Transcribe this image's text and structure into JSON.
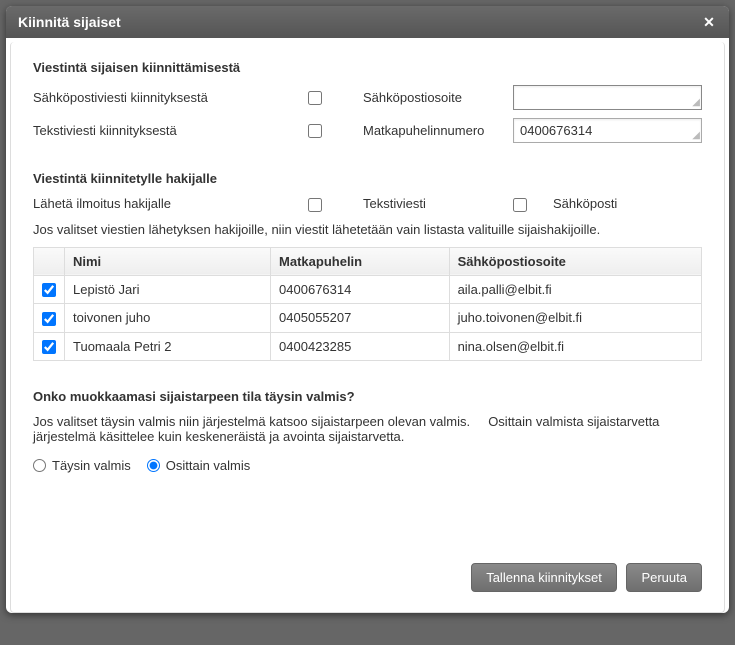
{
  "dialog": {
    "title": "Kiinnitä sijaiset"
  },
  "section1": {
    "heading": "Viestintä sijaisen kiinnittämisestä",
    "email_label": "Sähköpostiviesti kiinnityksestä",
    "email_addr_label": "Sähköpostiosoite",
    "email_addr_value": "",
    "sms_label": "Tekstiviesti kiinnityksestä",
    "phone_label": "Matkapuhelinnumero",
    "phone_value": "0400676314"
  },
  "section2": {
    "heading": "Viestintä kiinnitetylle hakijalle",
    "notify_label": "Lähetä ilmoitus hakijalle",
    "sms_option": "Tekstiviesti",
    "email_option": "Sähköposti",
    "help": "Jos valitset viestien lähetyksen hakijoille, niin viestit lähetetään vain listasta valituille sijaishakijoille."
  },
  "table": {
    "headers": {
      "name": "Nimi",
      "phone": "Matkapuhelin",
      "email": "Sähköpostiosoite"
    },
    "rows": [
      {
        "name": "Lepistö Jari",
        "phone": "0400676314",
        "email": "aila.palli@elbit.fi"
      },
      {
        "name": "toivonen juho",
        "phone": "0405055207",
        "email": "juho.toivonen@elbit.fi"
      },
      {
        "name": "Tuomaala Petri 2",
        "phone": "0400423285",
        "email": "nina.olsen@elbit.fi"
      }
    ]
  },
  "section3": {
    "heading": "Onko muokkaamasi sijaistarpeen tila täysin valmis?",
    "help_a": "Jos valitset täysin valmis niin järjestelmä katsoo sijaistarpeen olevan valmis.",
    "help_b": "Osittain valmista sijaistarvetta järjestelmä käsittelee kuin keskeneräistä ja avointa sijaistarvetta.",
    "opt_full": "Täysin valmis",
    "opt_partial": "Osittain valmis"
  },
  "buttons": {
    "save": "Tallenna kiinnitykset",
    "cancel": "Peruuta"
  }
}
